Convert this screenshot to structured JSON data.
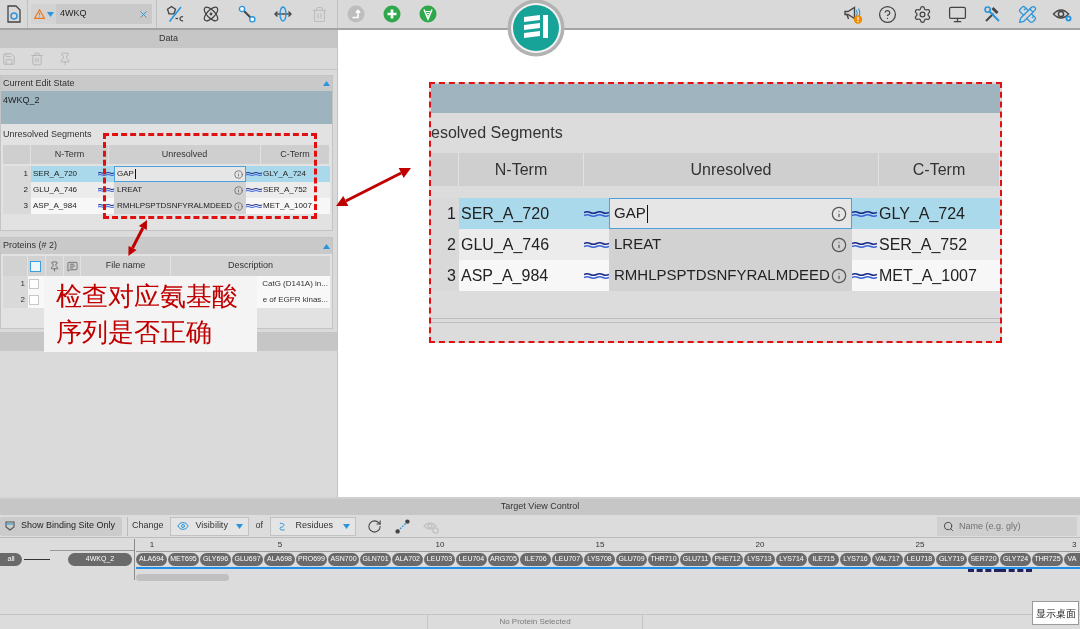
{
  "toolbar": {
    "structure_field": {
      "value": "4WKQ"
    },
    "left_tools": [
      {
        "kind": "ring-charge",
        "disabled": false
      },
      {
        "kind": "atom",
        "disabled": false
      },
      {
        "kind": "bond",
        "disabled": false
      },
      {
        "kind": "axis",
        "disabled": false
      },
      {
        "kind": "trash",
        "disabled": true
      }
    ],
    "mid_tools": [
      {
        "kind": "step",
        "disabled": true
      },
      {
        "kind": "add",
        "disabled": false
      },
      {
        "kind": "spring",
        "disabled": false
      }
    ],
    "right_tools": [
      {
        "kind": "announce",
        "alert": true
      },
      {
        "kind": "help"
      },
      {
        "kind": "settings"
      },
      {
        "kind": "display"
      },
      {
        "kind": "tools"
      },
      {
        "kind": "ruler"
      },
      {
        "kind": "view"
      }
    ]
  },
  "data_panel": {
    "title": "Data",
    "actions": [
      {
        "kind": "save",
        "disabled": true
      },
      {
        "kind": "trash",
        "disabled": true
      },
      {
        "kind": "pin",
        "disabled": true
      }
    ],
    "edit_state": {
      "title": "Current Edit State",
      "expanded": true,
      "value": "4WKQ_2",
      "segments_label": "Unresolved Segments",
      "columns": [
        "N-Term",
        "Unresolved",
        "C-Term"
      ],
      "rows": [
        {
          "index": "1",
          "n_term": "SER_A_720",
          "unresolved": "GAP",
          "c_term": "GLY_A_724",
          "selected": true,
          "editing": true
        },
        {
          "index": "2",
          "n_term": "GLU_A_746",
          "unresolved": "LREAT",
          "c_term": "SER_A_752",
          "selected": false,
          "editing": false
        },
        {
          "index": "3",
          "n_term": "ASP_A_984",
          "unresolved": "RMHLPSPTDSNFYRALMDEED",
          "c_term": "MET_A_1007",
          "selected": false,
          "editing": false
        }
      ]
    },
    "proteins": {
      "title": "Proteins (# 2)",
      "expanded": true,
      "select_all": {
        "checked": false
      },
      "columns": [
        "File name",
        "Description"
      ],
      "rows": [
        {
          "index": "1",
          "checked": false,
          "description": "CatG (D141A) in..."
        },
        {
          "index": "2",
          "checked": false,
          "description": "e of EGFR kinas..."
        }
      ]
    }
  },
  "annotation": {
    "note": "检查对应氨基酸序列是否正确"
  },
  "zoom_inset": {
    "section_label": "esolved Segments",
    "columns": [
      "N-Term",
      "Unresolved",
      "C-Term"
    ],
    "rows": [
      {
        "index": "1",
        "n_term": "SER_A_720",
        "unresolved": "GAP",
        "c_term": "GLY_A_724",
        "selected": true,
        "editing": true
      },
      {
        "index": "2",
        "n_term": "GLU_A_746",
        "unresolved": "LREAT",
        "c_term": "SER_A_752",
        "selected": false,
        "editing": false
      },
      {
        "index": "3",
        "n_term": "ASP_A_984",
        "unresolved": "RMHLPSPTDSNFYRALMDEED",
        "c_term": "MET_A_1007",
        "selected": false,
        "editing": false
      }
    ]
  },
  "target_view": {
    "title": "Target View Control",
    "binding_button": "Show Binding Site Only",
    "change_label": "Change",
    "property": "Visibility",
    "of_label": "of",
    "target": "Residues",
    "tools": [
      {
        "kind": "refresh",
        "disabled": false
      },
      {
        "kind": "connect",
        "disabled": false
      },
      {
        "kind": "hide",
        "disabled": true
      }
    ],
    "search": {
      "placeholder": "Name (e.g. gly)"
    },
    "all_label": "all",
    "chain": "4WKQ_2",
    "ruler": [
      "1",
      "5",
      "10",
      "15",
      "20",
      "25",
      "3"
    ],
    "residues": [
      {
        "name": "ALA694",
        "gap": false
      },
      {
        "name": "MET695",
        "gap": false
      },
      {
        "name": "GLY696",
        "gap": false
      },
      {
        "name": "GLU697",
        "gap": false
      },
      {
        "name": "ALA698",
        "gap": false
      },
      {
        "name": "PRO699",
        "gap": false
      },
      {
        "name": "ASN700",
        "gap": false
      },
      {
        "name": "GLN701",
        "gap": false
      },
      {
        "name": "ALA702",
        "gap": false
      },
      {
        "name": "LEU703",
        "gap": false
      },
      {
        "name": "LEU704",
        "gap": false
      },
      {
        "name": "ARG705",
        "gap": false
      },
      {
        "name": "ILE706",
        "gap": false
      },
      {
        "name": "LEU707",
        "gap": false
      },
      {
        "name": "LYS708",
        "gap": false
      },
      {
        "name": "GLU709",
        "gap": false
      },
      {
        "name": "THR710",
        "gap": false
      },
      {
        "name": "GLU711",
        "gap": false
      },
      {
        "name": "PHE712",
        "gap": false
      },
      {
        "name": "LYS713",
        "gap": false
      },
      {
        "name": "LYS714",
        "gap": false
      },
      {
        "name": "ILE715",
        "gap": false
      },
      {
        "name": "LYS716",
        "gap": false
      },
      {
        "name": "VAL717",
        "gap": false
      },
      {
        "name": "LEU718",
        "gap": false
      },
      {
        "name": "GLY719",
        "gap": false
      },
      {
        "name": "SER720",
        "gap": true
      },
      {
        "name": "GLY724",
        "gap": true
      },
      {
        "name": "THR725",
        "gap": false
      },
      {
        "name": "VA",
        "gap": false
      }
    ]
  },
  "status_bar": {
    "message": "No Protein Selected"
  },
  "tooltip": {
    "text": "显示桌面"
  }
}
